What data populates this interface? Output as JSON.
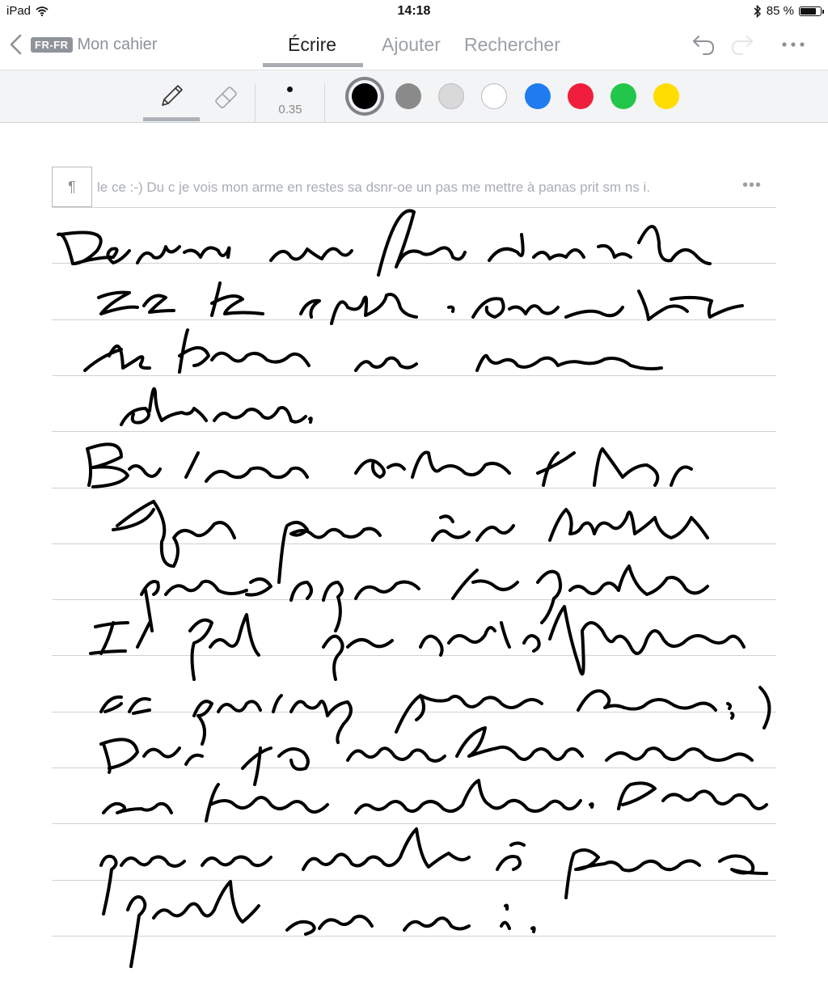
{
  "status_bar": {
    "device": "iPad",
    "time": "14:18",
    "battery_percent": "85 %",
    "battery_level": 0.85
  },
  "nav": {
    "language_badge": "FR-FR",
    "notebook_title": "Mon cahier",
    "tabs": [
      {
        "label": "Écrire",
        "active": true
      },
      {
        "label": "Ajouter",
        "active": false
      },
      {
        "label": "Rechercher",
        "active": false
      }
    ]
  },
  "toolbar": {
    "stroke_size": "0.35",
    "active_tool": "pen",
    "colors": [
      "#000000",
      "#8a8a8a",
      "#d9d9d9",
      "#ffffff",
      "#1e7cf0",
      "#f01e3c",
      "#22c64a",
      "#ffdd00"
    ],
    "selected_color": "#000000"
  },
  "recognition": {
    "text": "le ce :-) Du c je vois mon arme en restes sa dsnr-oe un pas me mettre à panas prit sm ns i."
  },
  "page": {
    "ruled_line_count": 14
  }
}
